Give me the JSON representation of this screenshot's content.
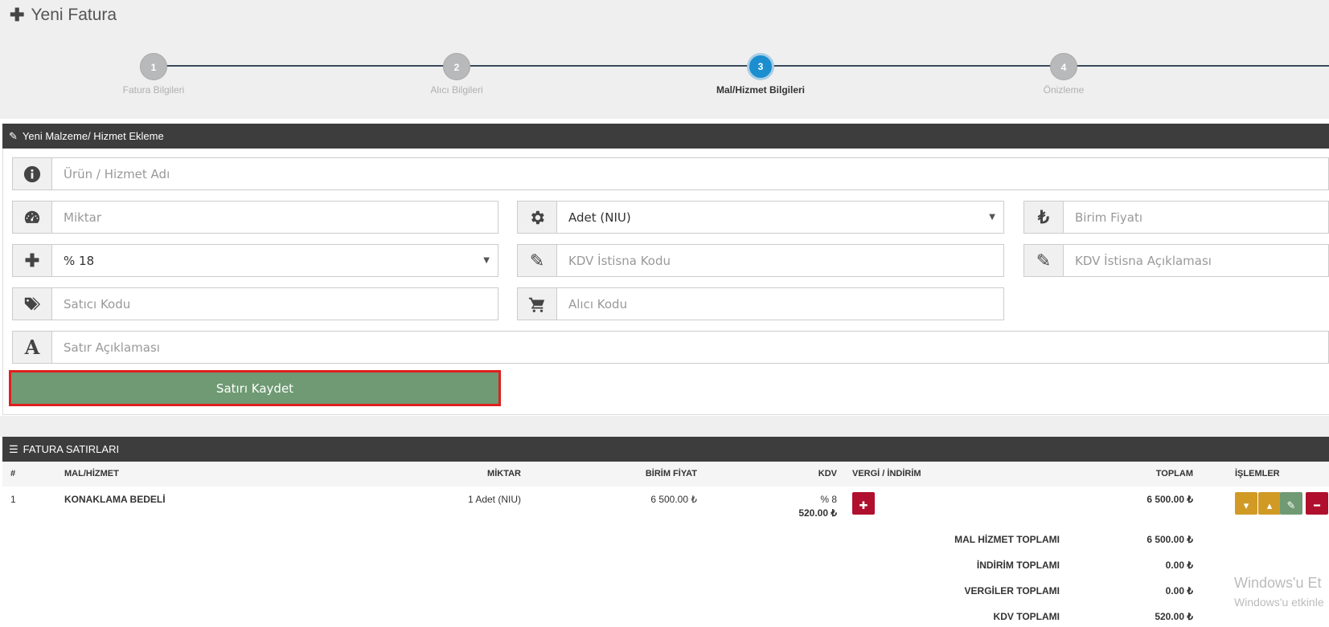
{
  "page": {
    "title": "Yeni Fatura"
  },
  "wizard": {
    "steps": [
      {
        "number": "1",
        "label": "Fatura Bilgileri"
      },
      {
        "number": "2",
        "label": "Alıcı Bilgileri"
      },
      {
        "number": "3",
        "label": "Mal/Hizmet Bilgileri"
      },
      {
        "number": "4",
        "label": "Önizleme"
      }
    ],
    "active_step": 3
  },
  "form": {
    "panel_title": "Yeni Malzeme/ Hizmet Ekleme",
    "product_name_placeholder": "Ürün / Hizmet Adı",
    "quantity_placeholder": "Miktar",
    "unit_value": "Adet (NIU)",
    "unit_price_placeholder": "Birim Fiyatı",
    "vat_rate_value": "% 18",
    "vat_exemption_code_placeholder": "KDV İstisna Kodu",
    "vat_exemption_desc_placeholder": "KDV İstisna Açıklaması",
    "seller_code_placeholder": "Satıcı Kodu",
    "buyer_code_placeholder": "Alıcı Kodu",
    "line_desc_placeholder": "Satır Açıklaması",
    "save_label": "Satırı Kaydet"
  },
  "invoice_lines": {
    "panel_title": "FATURA SATIRLARI",
    "headers": {
      "num": "#",
      "item": "MAL/HİZMET",
      "qty": "MİKTAR",
      "unit_price": "BİRİM FİYAT",
      "vat": "KDV",
      "tax_discount": "VERGİ / İNDİRİM",
      "total": "TOPLAM",
      "actions": "İŞLEMLER"
    },
    "rows": [
      {
        "num": "1",
        "item": "KONAKLAMA BEDELİ",
        "qty": "1 Adet (NIU)",
        "unit_price": "6 500.00 ₺",
        "vat_rate": "% 8",
        "vat_amount": "520.00 ₺",
        "total": "6 500.00 ₺"
      }
    ],
    "totals": [
      {
        "label": "MAL HİZMET TOPLAMI",
        "value": "6 500.00 ₺"
      },
      {
        "label": "İNDİRİM TOPLAMI",
        "value": "0.00 ₺"
      },
      {
        "label": "VERGİLER TOPLAMI",
        "value": "0.00 ₺"
      },
      {
        "label": "KDV TOPLAMI",
        "value": "520.00 ₺"
      }
    ]
  },
  "watermark": {
    "line1": "Windows'u Et",
    "line2": "Windows'u etkinle"
  },
  "colors": {
    "accent": "#1b8ecf",
    "save": "#6f9a73",
    "danger": "#b0102e",
    "warning": "#d09a25",
    "edit": "#6f9a73"
  }
}
